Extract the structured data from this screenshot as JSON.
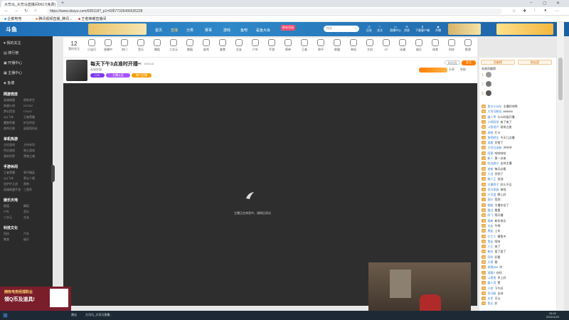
{
  "browser": {
    "tabs": [
      "大司马_大司马直播间0617(免费)",
      ""
    ],
    "url": "https://www.douyu.com/606118?_p1=60677326496535228",
    "bookmarks": [
      "企鹅电竞",
      "腾讯视频直播_腾讯...",
      "王者荣耀直播间"
    ]
  },
  "nav": {
    "logo": "斗鱼",
    "links": [
      "首页",
      "直播",
      "分类",
      "赛事",
      "游戏",
      "鱼吧",
      "鲨鱼大会"
    ],
    "new_badge": "新年活动",
    "search_placeholder": "搜索",
    "icons": [
      "历史",
      "关注",
      "直播中心",
      "消息",
      "下载客户端",
      "开播"
    ]
  },
  "sidebar": {
    "top": [
      "我的关注",
      "排行榜",
      "开播中心",
      "主播中心",
      "鱼塘"
    ],
    "sections": [
      {
        "title": "网游竞技",
        "items": [
          [
            "英雄联盟",
            "绝地求生"
          ],
          [
            "穿越火线",
            "DOTA2"
          ],
          [
            "梦幻西游",
            "CSGO"
          ],
          [
            "QQ飞车",
            "王者荣耀"
          ],
          [
            "魔兽争霸",
            "炉石传说"
          ],
          [
            "使命召唤",
            "逃离塔科夫"
          ]
        ]
      },
      {
        "title": "单机热游",
        "items": [
          [
            "主机游戏",
            "方舟系列"
          ],
          [
            "怀旧游戏",
            "独立游戏"
          ],
          [
            "我的世界",
            "黑暗之魂"
          ]
        ]
      },
      {
        "title": "手游休闲",
        "items": [
          [
            "王者荣耀",
            "和平精英"
          ],
          [
            "QQ飞车",
            "第五人格"
          ],
          [
            "金铲铲之战",
            "原神"
          ],
          [
            "英雄联盟手游",
            "三国杀"
          ]
        ]
      },
      {
        "title": "娱乐天地",
        "items": [
          [
            "颜值",
            "舞蹈"
          ],
          [
            "户外",
            "音乐"
          ],
          [
            "二次元",
            "交友"
          ]
        ]
      },
      {
        "title": "科技文化",
        "items": [
          [
            "科技",
            "汽车"
          ],
          [
            "教育",
            "娱乐"
          ]
        ]
      }
    ]
  },
  "categories": [
    "小宝贝",
    "直播中",
    "热门",
    "音乐",
    "舞蹈",
    "二次元",
    "颜值",
    "星秀",
    "美食",
    "交友",
    "户外",
    "手游",
    "原神",
    "王者",
    "和平",
    "联盟",
    "单机",
    "主机",
    "CF",
    "动漫",
    "娱乐",
    "体育",
    "科技",
    "影视"
  ],
  "room": {
    "title": "每天下午3点准时开播~",
    "followers": "12",
    "id_label": "房间号：606118",
    "category": "英雄联盟",
    "tags": [
      "LOL",
      "主播认证",
      "热门主播"
    ],
    "buttons": [
      "关注",
      "分享",
      "举报"
    ],
    "fans_count": "粉丝团"
  },
  "player": {
    "loading_text": "主播正在休息中，请稍后再试"
  },
  "right": {
    "tabs": [
      "贡献榜",
      "粉丝团"
    ],
    "rank_title": "本周贡献榜",
    "rank": [
      "1",
      "2",
      "3"
    ],
    "chat": [
      [
        "30",
        "鱼丸小分队",
        "主播好帅啊"
      ],
      [
        "32",
        "大司马粉丝",
        "666666"
      ],
      [
        "28",
        "路人甲",
        "什么时候开播"
      ],
      [
        "15",
        "小明同学",
        "来了来了"
      ],
      [
        "40",
        "斗鱼用户",
        "前排占座"
      ],
      [
        "21",
        "老铁",
        "打卡"
      ],
      [
        "18",
        "鱼吧吧主",
        "今天几点播"
      ],
      [
        "25",
        "游客",
        "厉害了"
      ],
      [
        "33",
        "大司马忠粉",
        "冲冲冲"
      ],
      [
        "19",
        "阿星",
        "哈哈哈哈"
      ],
      [
        "12",
        "新人",
        "第一次来"
      ],
      [
        "27",
        "吃瓜群众",
        "支持主播"
      ],
      [
        "35",
        "老粉",
        "每天必看"
      ],
      [
        "22",
        "小白",
        "学到了"
      ],
      [
        "16",
        "路人乙",
        "加油"
      ],
      [
        "30",
        "大猪蹄子",
        "好久不见"
      ],
      [
        "24",
        "司马家族",
        "来啦"
      ],
      [
        "29",
        "小可爱",
        "晚上好"
      ],
      [
        "17",
        "观众",
        "签到"
      ],
      [
        "31",
        "铁粉",
        "主播辛苦了"
      ],
      [
        "20",
        "路过",
        "看看"
      ],
      [
        "26",
        "阿飞",
        "等开播"
      ],
      [
        "14",
        "萌新",
        "新年快乐"
      ],
      [
        "33",
        "水友",
        "牛啊"
      ],
      [
        "23",
        "朋友",
        "上车"
      ],
      [
        "19",
        "打工人",
        "摸鱼中"
      ],
      [
        "28",
        "鱼友",
        "哈哈"
      ],
      [
        "21",
        "小王",
        "来了"
      ],
      [
        "25",
        "粉丝",
        "爱了爱了"
      ],
      [
        "18",
        "同学",
        "好看"
      ],
      [
        "30",
        "大哥",
        "稳"
      ],
      [
        "16",
        "老铁666",
        "冲"
      ],
      [
        "27",
        "游客2",
        "在吗"
      ],
      [
        "22",
        "斗鱼鱼",
        "早上好"
      ],
      [
        "24",
        "路人丙",
        "赞"
      ],
      [
        "20",
        "小李",
        "下午好"
      ],
      [
        "26",
        "司马粉",
        "支持"
      ],
      [
        "15",
        "水军",
        "可以"
      ],
      [
        "29",
        "鱼丸",
        "好"
      ]
    ]
  },
  "ad": {
    "line1": "拥有电竞经理职业",
    "line2": "领Q币及道具!"
  },
  "taskbar": {
    "apps": [
      "建议",
      "大司马_大司马直播..."
    ],
    "time": "15:02",
    "date": "2022/1/23"
  },
  "colors": {
    "brand": "#2f88c8",
    "orange": "#ff7d00",
    "sidebar": "#2b2b2b"
  }
}
